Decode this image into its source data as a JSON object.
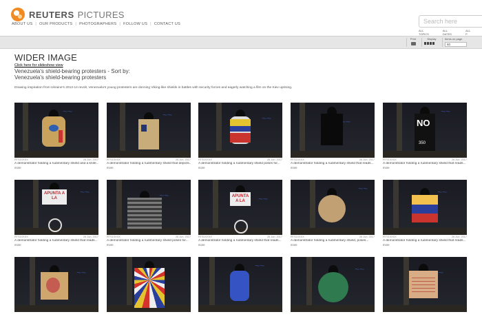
{
  "brand": {
    "name": "REUTERS",
    "sub": "PICTURES"
  },
  "nav": [
    "ABOUT US",
    "OUR PRODUCTS",
    "PHOTOGRAPHERS",
    "FOLLOW US",
    "CONTACT US"
  ],
  "search": {
    "placeholder": "Search here"
  },
  "filters": [
    "ALL TOPICS",
    "ALL DATES",
    "ALL P"
  ],
  "toolbar": {
    "print_label": "Print",
    "display_label": "Display",
    "items_label": "Items on page",
    "items_value": "60"
  },
  "page": {
    "section_title": "WIDER IMAGE",
    "slideshow_link": "Click here for slideshow view",
    "gallery_title": "Venezuela's shield-bearing protesters - Sort by:",
    "gallery_subtitle": "Venezuela's shield-bearing protesters",
    "description": "Drawing inspiration from Ukraine's 2013-14 revolt, Venezuela's young protesters are donning Viking-like shields in battles with security forces and eagerly watching a film on the Kiev uprising."
  },
  "accent_colors": {
    "logo": "#f08a24",
    "graffiti": "#3a4f9a"
  },
  "items": [
    {
      "id": "RTS1XXXX",
      "date": "26 Jun. 2017",
      "caption": "A demonstrator holding a rudimentary shield and a knife...",
      "more": "more"
    },
    {
      "id": "RTS1XXXX",
      "date": "26 Jun. 2017",
      "caption": "A demonstrator holding a rudimentary shield that depicts...",
      "more": "more"
    },
    {
      "id": "RTS1XXXX",
      "date": "26 Jun. 2017",
      "caption": "A demonstrator holding a rudimentary shield poses for...",
      "more": "more"
    },
    {
      "id": "RTS1XXXX",
      "date": "26 Jun. 2017",
      "caption": "A demonstrator holding a rudimentary shield that reads...",
      "more": "more"
    },
    {
      "id": "RTS1XXXX",
      "date": "26 Jun. 2017",
      "caption": "A demonstrator holding a rudimentary shield that reads...",
      "more": "more"
    },
    {
      "id": "RTS1XXXX",
      "date": "26 Jun. 2017",
      "caption": "A demonstrator holding a rudimentary shield that reads...",
      "more": "more"
    },
    {
      "id": "RTS1XXXX",
      "date": "26 Jun. 2017",
      "caption": "A demonstrator holding a rudimentary shield poses for...",
      "more": "more"
    },
    {
      "id": "RTS1XXXX",
      "date": "26 Jun. 2017",
      "caption": "A demonstrator holding a rudimentary shield that reads...",
      "more": "more"
    },
    {
      "id": "RTS1XXXX",
      "date": "26 Jun. 2017",
      "caption": "A demonstrator holding a rudimentary shield, poses...",
      "more": "more"
    },
    {
      "id": "RTS1XXXX",
      "date": "26 Jun. 2017",
      "caption": "A demonstrator holding a rudimentary shield that reads...",
      "more": "more"
    },
    {
      "id": "",
      "date": "",
      "caption": "",
      "more": ""
    },
    {
      "id": "",
      "date": "",
      "caption": "",
      "more": ""
    },
    {
      "id": "",
      "date": "",
      "caption": "",
      "more": ""
    },
    {
      "id": "",
      "date": "",
      "caption": "",
      "more": ""
    },
    {
      "id": "",
      "date": "",
      "caption": "",
      "more": ""
    }
  ],
  "shield_texts": {
    "no": "NO",
    "no_num": "350",
    "apunta": "APUNTA A LA"
  }
}
